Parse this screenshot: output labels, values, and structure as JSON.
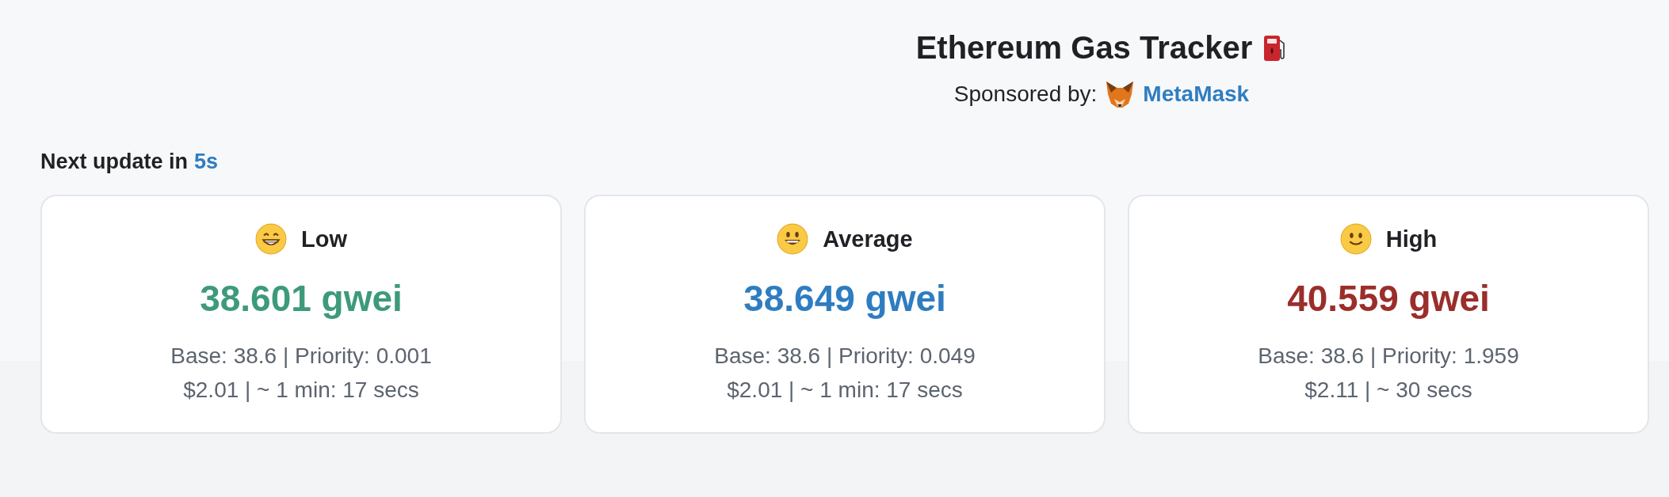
{
  "header": {
    "title": "Ethereum Gas Tracker",
    "sponsor_label": "Sponsored by:",
    "sponsor_name": "MetaMask"
  },
  "update": {
    "label": "Next update in",
    "value": "5s"
  },
  "tiers": [
    {
      "kind": "grin",
      "label": "Low",
      "price": "38.601 gwei",
      "color": "#3d9a7a",
      "fees": "Base: 38.6 | Priority: 0.001",
      "estimate": "$2.01 | ~ 1 min: 17 secs"
    },
    {
      "kind": "grinning",
      "label": "Average",
      "price": "38.649 gwei",
      "color": "#2f7dc0",
      "fees": "Base: 38.6 | Priority: 0.049",
      "estimate": "$2.01 | ~ 1 min: 17 secs"
    },
    {
      "kind": "smile",
      "label": "High",
      "price": "40.559 gwei",
      "color": "#9a2e2b",
      "fees": "Base: 38.6 | Priority: 1.959",
      "estimate": "$2.11 | ~ 30 secs"
    }
  ]
}
